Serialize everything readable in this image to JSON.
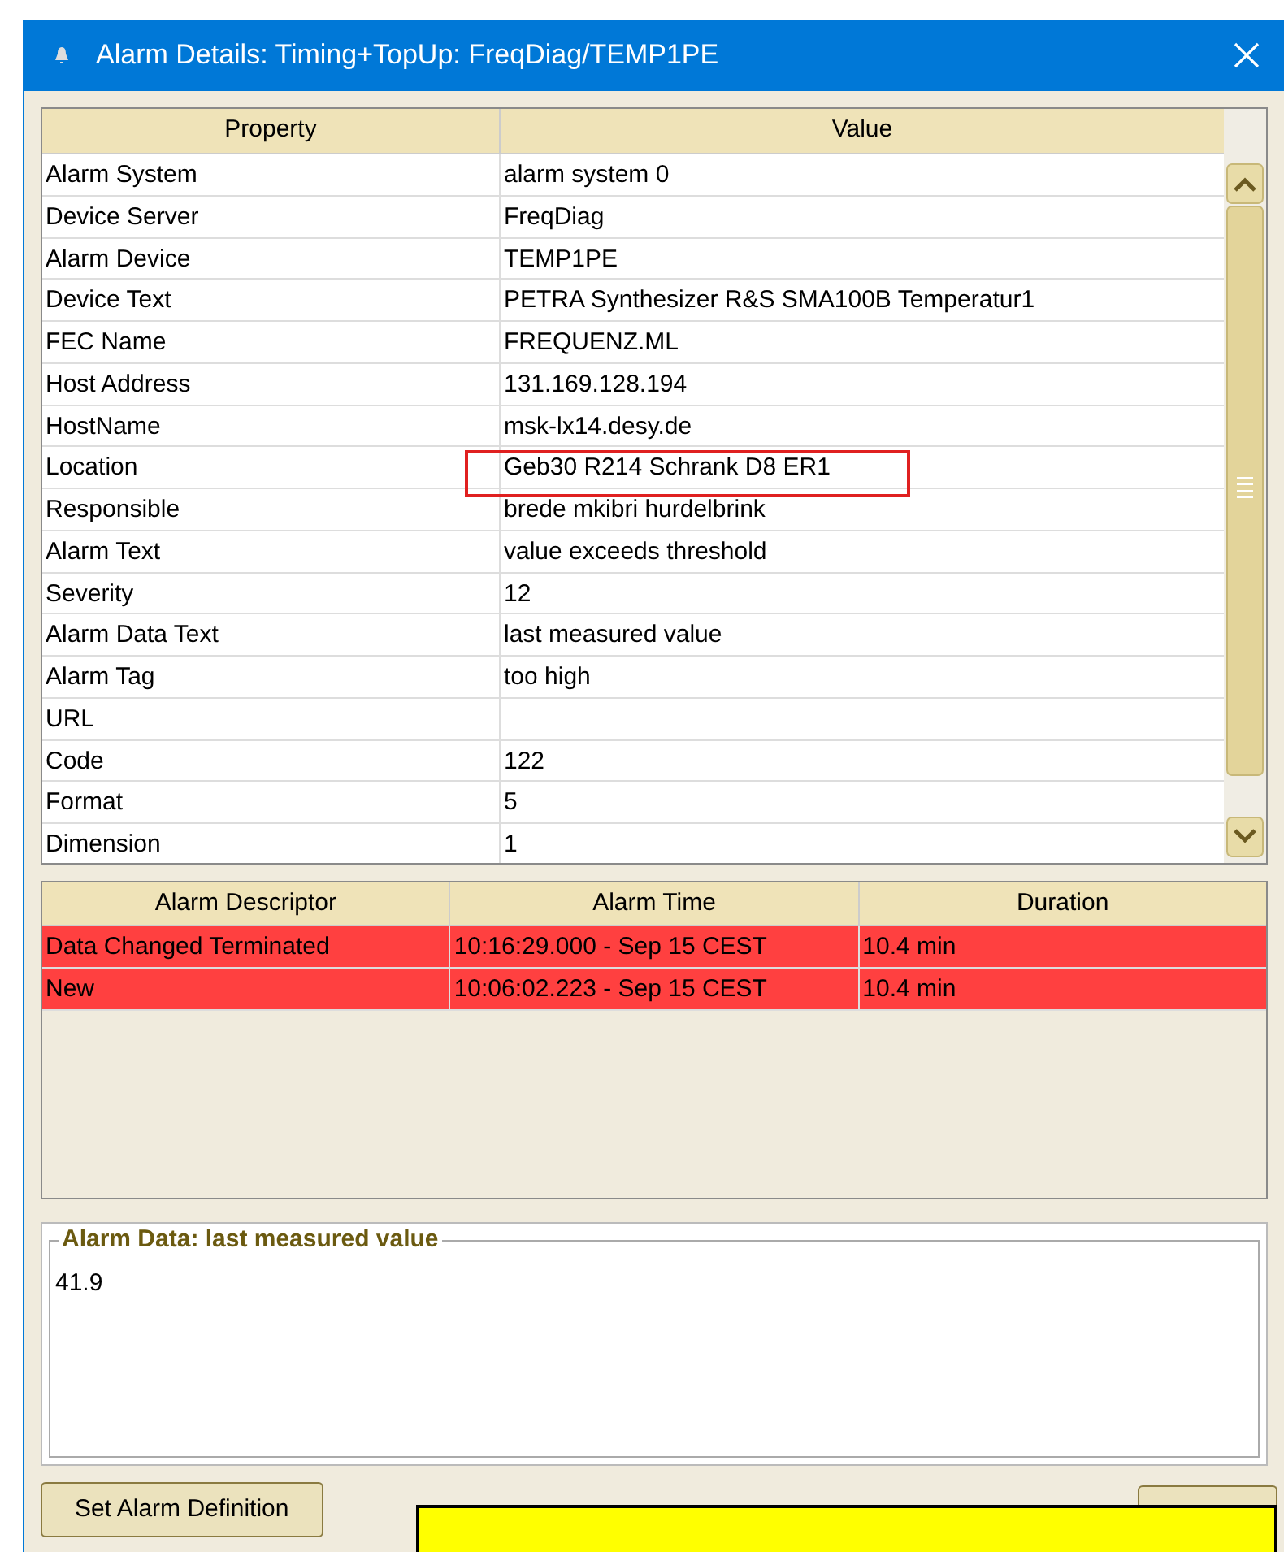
{
  "window": {
    "title": "Alarm Details: Timing+TopUp: FreqDiag/TEMP1PE"
  },
  "property_table": {
    "columns": [
      "Property",
      "Value"
    ],
    "rows": [
      {
        "property": "Alarm System",
        "value": "alarm system 0"
      },
      {
        "property": "Device Server",
        "value": "FreqDiag"
      },
      {
        "property": "Alarm Device",
        "value": "TEMP1PE"
      },
      {
        "property": "Device Text",
        "value": "PETRA Synthesizer R&S SMA100B Temperatur1"
      },
      {
        "property": "FEC Name",
        "value": "FREQUENZ.ML"
      },
      {
        "property": "Host Address",
        "value": "131.169.128.194"
      },
      {
        "property": "HostName",
        "value": "msk-lx14.desy.de"
      },
      {
        "property": "Location",
        "value": "Geb30 R214 Schrank D8 ER1"
      },
      {
        "property": "Responsible",
        "value": "brede mkibri hurdelbrink"
      },
      {
        "property": "Alarm Text",
        "value": "value exceeds threshold"
      },
      {
        "property": "Severity",
        "value": "12"
      },
      {
        "property": "Alarm Data Text",
        "value": "last measured value"
      },
      {
        "property": "Alarm Tag",
        "value": "too high"
      },
      {
        "property": "URL",
        "value": ""
      },
      {
        "property": "Code",
        "value": "122"
      },
      {
        "property": "Format",
        "value": "5"
      },
      {
        "property": "Dimension",
        "value": "1"
      }
    ]
  },
  "history_table": {
    "columns": [
      "Alarm Descriptor",
      "Alarm Time",
      "Duration"
    ],
    "rows": [
      {
        "descriptor": "Data Changed Terminated",
        "time": "10:16:29.000 - Sep 15 CEST",
        "duration": "10.4 min"
      },
      {
        "descriptor": "New",
        "time": "10:06:02.223 - Sep 15 CEST",
        "duration": "10.4 min"
      }
    ]
  },
  "alarm_data": {
    "title": "Alarm Data: last measured value",
    "value": "41.9"
  },
  "buttons": [
    "Set Alarm Definition"
  ]
}
